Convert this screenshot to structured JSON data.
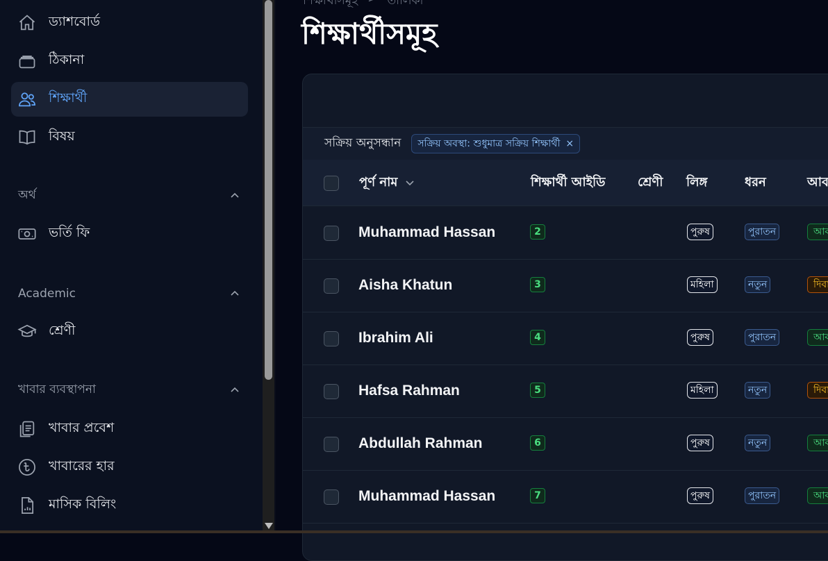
{
  "sidebar": {
    "items": [
      {
        "label": "ড্যাশবোর্ড",
        "icon": "home-icon",
        "active": false
      },
      {
        "label": "ঠিকানা",
        "icon": "stack-icon",
        "active": false
      },
      {
        "label": "শিক্ষার্থী",
        "icon": "users-icon",
        "active": true
      },
      {
        "label": "বিষয়",
        "icon": "book-icon",
        "active": false
      }
    ],
    "groups": [
      {
        "label": "অর্থ",
        "items": [
          {
            "label": "ভর্তি ফি",
            "icon": "banknote-icon"
          }
        ]
      },
      {
        "label": "Academic",
        "items": [
          {
            "label": "শ্রেণী",
            "icon": "graduation-cap-icon"
          }
        ]
      },
      {
        "label": "খাবার ব্যবস্থাপনা",
        "items": [
          {
            "label": "খাবার প্রবেশ",
            "icon": "clipboard-list-icon"
          },
          {
            "label": "খাবারের হার",
            "icon": "taka-icon"
          },
          {
            "label": "মাসিক বিলিং",
            "icon": "document-chart-icon"
          }
        ]
      }
    ]
  },
  "breadcrumb": [
    "শিক্ষার্থীসমূহ",
    "তালিকা"
  ],
  "page_title": "শিক্ষার্থীসমূহ",
  "filters": {
    "label": "সক্রিয় অনুসন্ধান",
    "chip": "সক্রিয় অবস্থা: শুধুমাত্র সক্রিয় শিক্ষার্থী",
    "chip_remove": "×"
  },
  "table": {
    "columns": [
      "পূর্ণ নাম",
      "শিক্ষার্থী আইডি",
      "শ্রেণী",
      "লিঙ্গ",
      "ধরন",
      "আবাসিক"
    ],
    "rows": [
      {
        "name": "Muhammad Hassan",
        "id": "2",
        "gender": "পুরুষ",
        "type": "পুরাতন",
        "extra": "আবাসিক",
        "extra_color": "green"
      },
      {
        "name": "Aisha Khatun",
        "id": "3",
        "gender": "মহিলা",
        "type": "নতুন",
        "extra": "দিবা",
        "extra_color": "amber"
      },
      {
        "name": "Ibrahim Ali",
        "id": "4",
        "gender": "পুরুষ",
        "type": "পুরাতন",
        "extra": "আবাসিক",
        "extra_color": "green"
      },
      {
        "name": "Hafsa Rahman",
        "id": "5",
        "gender": "মহিলা",
        "type": "নতুন",
        "extra": "দিবা",
        "extra_color": "amber"
      },
      {
        "name": "Abdullah Rahman",
        "id": "6",
        "gender": "পুরুষ",
        "type": "নতুন",
        "extra": "আবাসিক",
        "extra_color": "green"
      },
      {
        "name": "Muhammad Hassan",
        "id": "7",
        "gender": "পুরুষ",
        "type": "পুরাতন",
        "extra": "আবাসিক",
        "extra_color": "green"
      }
    ]
  },
  "colors": {
    "accent": "#60a5fa",
    "success": "#4ade80",
    "warning": "#fbbf24"
  }
}
